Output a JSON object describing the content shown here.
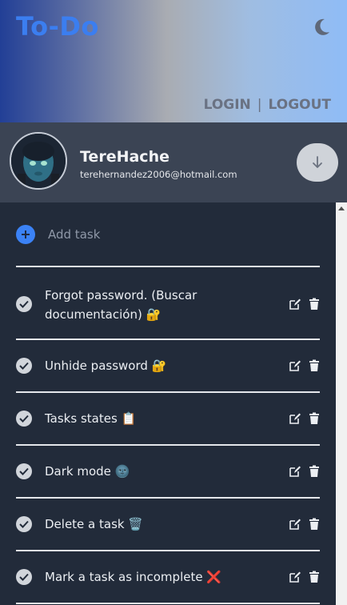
{
  "header": {
    "title": "To-Do",
    "theme_icon": "moon-icon",
    "login_label": "LOGIN",
    "separator": "|",
    "logout_label": "LOGOUT"
  },
  "profile": {
    "username": "TereHache",
    "email": "terehernandez2006@hotmail.com",
    "toggle_icon": "arrow-down-icon"
  },
  "add_task": {
    "label": "Add task",
    "icon": "plus-icon"
  },
  "tasks": [
    {
      "text": "Forgot password. (Buscar documentación) 🔐",
      "status": "completed"
    },
    {
      "text": "Unhide password 🔐",
      "status": "completed"
    },
    {
      "text": "Tasks states 📋",
      "status": "completed"
    },
    {
      "text": "Dark mode 🌚",
      "status": "completed"
    },
    {
      "text": "Delete a task 🗑️",
      "status": "completed"
    },
    {
      "text": "Mark a task as incomplete ❌",
      "status": "completed"
    }
  ],
  "colors": {
    "accent": "#3b82f6",
    "background": "#222b3a",
    "profile_bg": "#3b4454"
  }
}
